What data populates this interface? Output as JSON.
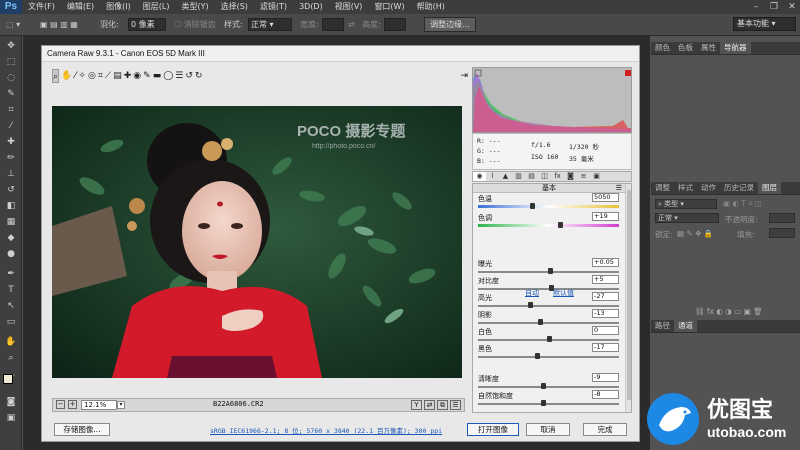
{
  "menubar": {
    "logo": "Ps",
    "items": [
      "文件(F)",
      "编辑(E)",
      "图像(I)",
      "图层(L)",
      "类型(Y)",
      "选择(S)",
      "滤镜(T)",
      "3D(D)",
      "视图(V)",
      "窗口(W)",
      "帮助(H)"
    ],
    "minimize": "–",
    "restore": "❐",
    "close": "✕"
  },
  "optionsbar": {
    "feather_label": "羽化:",
    "feather_value": "0 像素",
    "antialias_label": "消除锯齿",
    "style_label": "样式:",
    "style_value": "正常",
    "width_label": "宽度:",
    "height_label": "高度:",
    "refine_edge": "调整边缘...",
    "workspace": "基本功能"
  },
  "right_panels": {
    "top_tabs": [
      "颜色",
      "色板",
      "属性",
      "导航器"
    ],
    "layers_tabs": [
      "调整",
      "样式",
      "动作",
      "历史记录",
      "图层"
    ],
    "kind_label": "类型",
    "blend_mode": "正常",
    "opacity_label": "不透明度:",
    "lock_label": "锁定:",
    "fill_label": "填充:",
    "paths_tabs": [
      "路径",
      "通道"
    ]
  },
  "camera_raw": {
    "title": "Camera Raw 9.3.1 -  Canon EOS 5D Mark III",
    "watermark_brand": "POCO 摄影专题",
    "watermark_url": "http://photo.poco.cn/",
    "zoom": "12.1%",
    "filename": "B22A6806.CR2",
    "info": {
      "r": "R:  ---",
      "g": "G:  ---",
      "b": "B:  ---",
      "aperture": "f/1.6",
      "shutter": "1/320 秒",
      "iso": "ISO 160",
      "focal": "35 毫米"
    },
    "section_title": "基本",
    "auto": "自动",
    "default": "默认值",
    "sliders": [
      {
        "label": "色温",
        "value": "5050",
        "pos": 0.38
      },
      {
        "label": "色调",
        "value": "+19",
        "pos": 0.58
      },
      {
        "label": "曝光",
        "value": "+0.05",
        "pos": 0.51
      },
      {
        "label": "对比度",
        "value": "+5",
        "pos": 0.52
      },
      {
        "label": "高光",
        "value": "-27",
        "pos": 0.37
      },
      {
        "label": "阴影",
        "value": "-13",
        "pos": 0.44
      },
      {
        "label": "白色",
        "value": "0",
        "pos": 0.5
      },
      {
        "label": "黑色",
        "value": "-17",
        "pos": 0.42
      },
      {
        "label": "清晰度",
        "value": "-9",
        "pos": 0.46
      },
      {
        "label": "自然饱和度",
        "value": "-8",
        "pos": 0.46
      }
    ],
    "buttons": {
      "save": "存储图像...",
      "workflow": "sRGB IEC61966-2.1; 8 位; 5760 x 3840 (22.1 百万像素); 300 ppi",
      "open": "打开图像",
      "cancel": "取消",
      "done": "完成"
    }
  },
  "watermark": {
    "site_cn": "优图宝",
    "site_url": "utobao.com"
  },
  "colors": {
    "accent": "#1e88e5",
    "lip_red": "#c0162a",
    "garment_red": "#d21a2a"
  }
}
